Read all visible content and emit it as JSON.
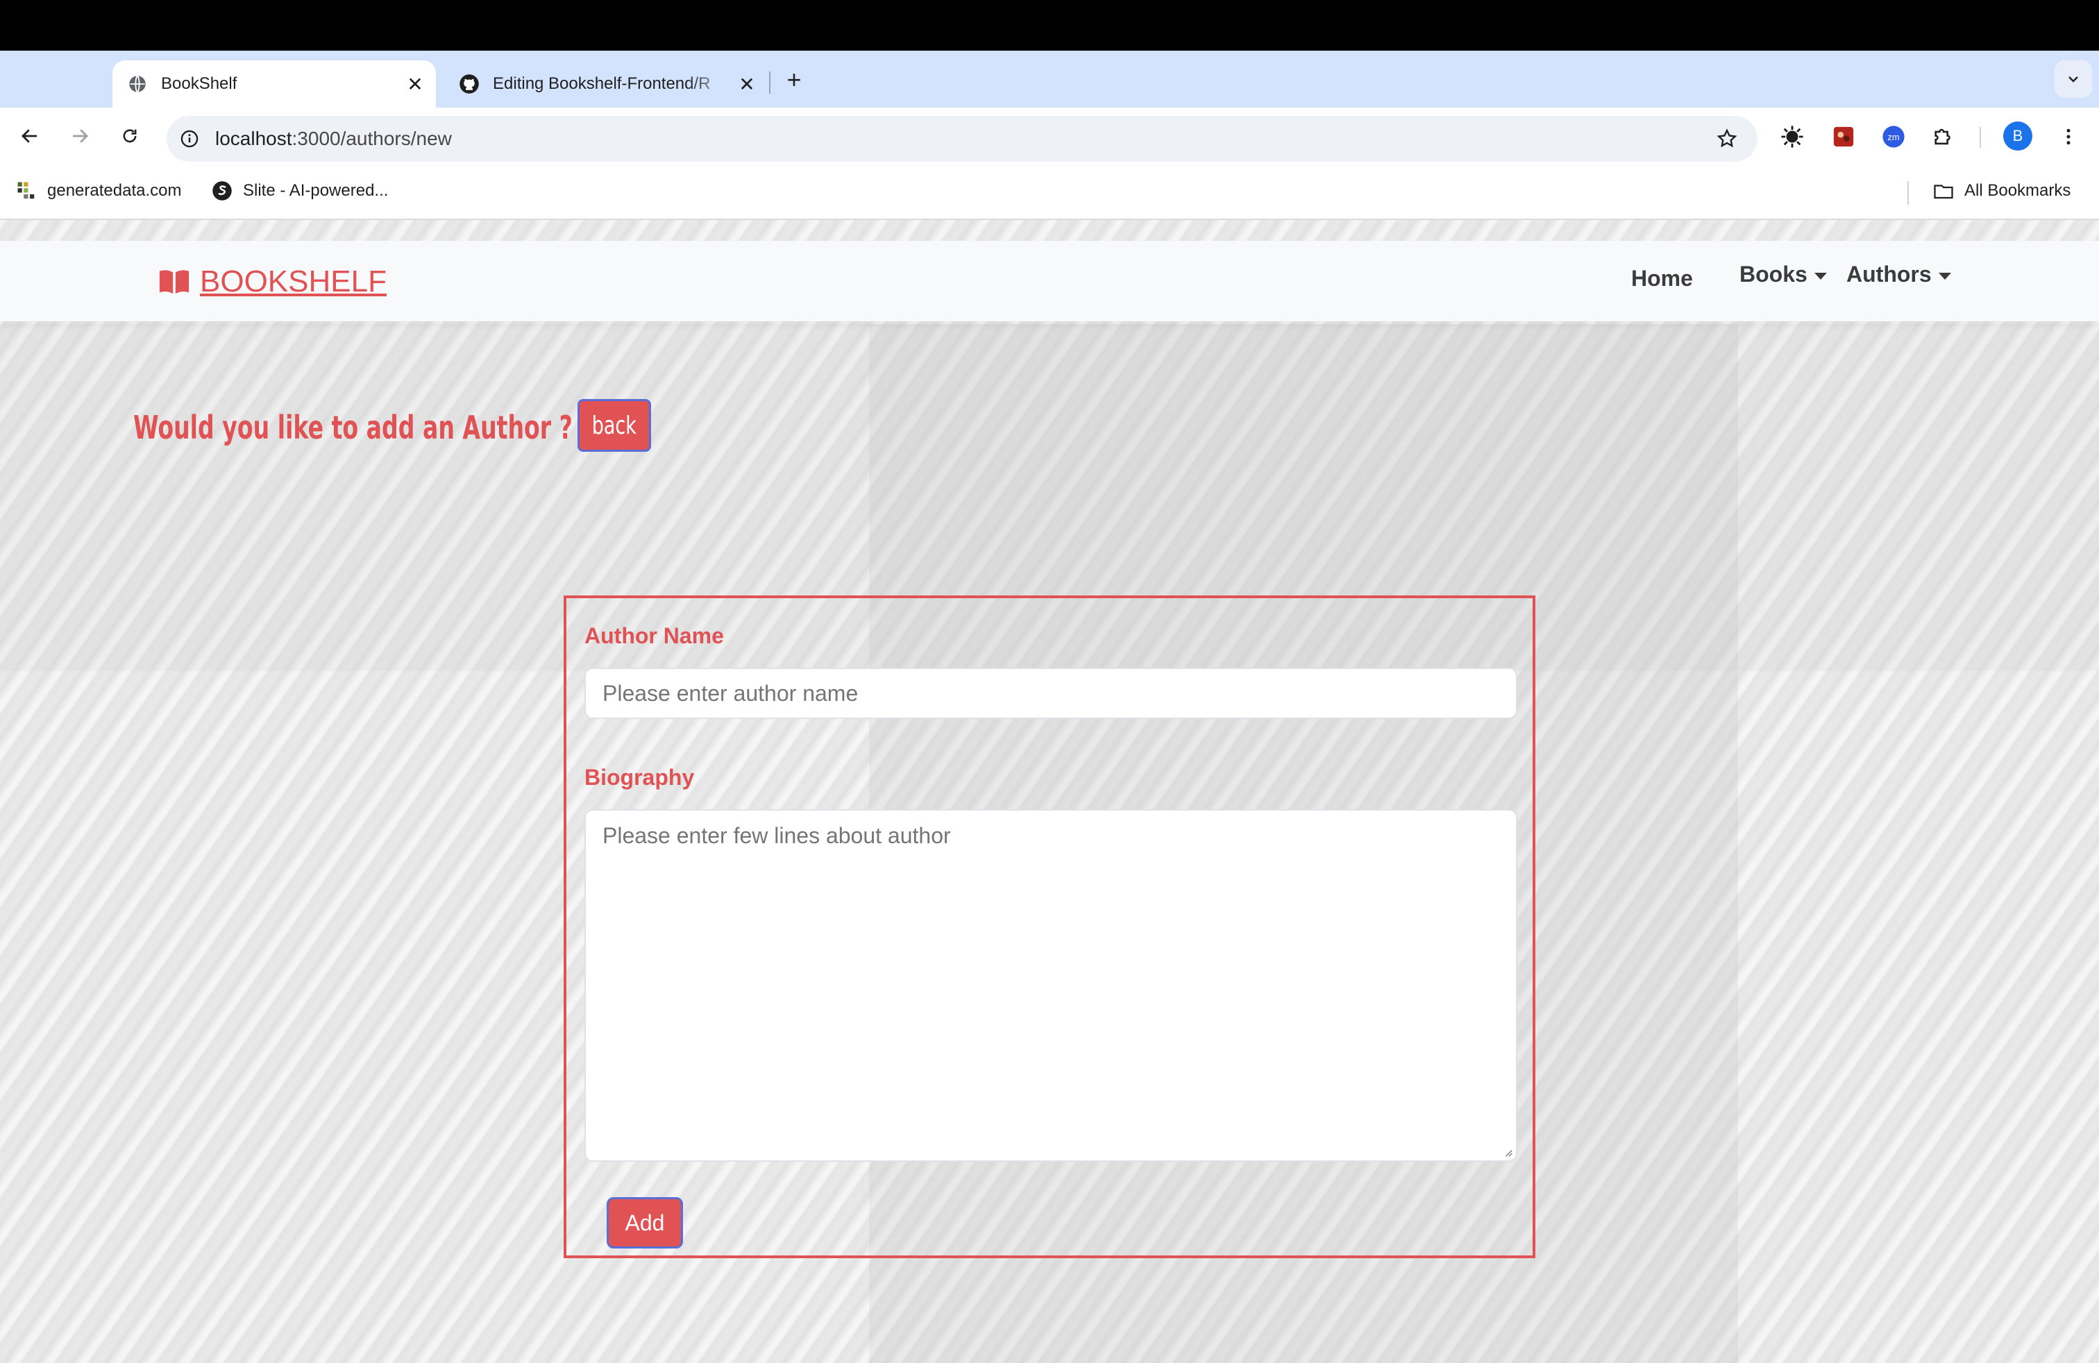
{
  "browser": {
    "tabs": [
      {
        "title": "BookShelf",
        "icon": "globe-icon",
        "active": true
      },
      {
        "title": "Editing Bookshelf-Frontend/R",
        "icon": "github-icon",
        "active": false
      }
    ],
    "url": "localhost:3000/authors/new",
    "url_host": "localhost",
    "url_rest": ":3000/authors/new",
    "profile_initial": "B",
    "extensions": [
      "sun-extension-icon",
      "red-extension-icon",
      "zoom-extension-icon",
      "puzzle-icon"
    ],
    "zoom_ext_label": "zm"
  },
  "bookmarks": {
    "items": [
      {
        "label": "generatedata.com",
        "icon": "generatedata-icon"
      },
      {
        "label": "Slite - AI-powered...",
        "icon": "slite-icon"
      }
    ],
    "all_label": "All Bookmarks"
  },
  "navbar": {
    "brand": "BOOKSHELF",
    "links": [
      {
        "label": "Home",
        "dropdown": false
      },
      {
        "label": "Books",
        "dropdown": true
      },
      {
        "label": "Authors",
        "dropdown": true
      }
    ]
  },
  "page": {
    "heading": "Would you like to add an Author ?",
    "back_label": "back",
    "form": {
      "name_label": "Author Name",
      "name_placeholder": "Please enter author name",
      "bio_label": "Biography",
      "bio_placeholder": "Please enter few lines about author",
      "submit_label": "Add"
    }
  },
  "colors": {
    "accent": "#e05253",
    "button_border": "#5a6fd6",
    "tab_strip": "#d3e3fd"
  }
}
